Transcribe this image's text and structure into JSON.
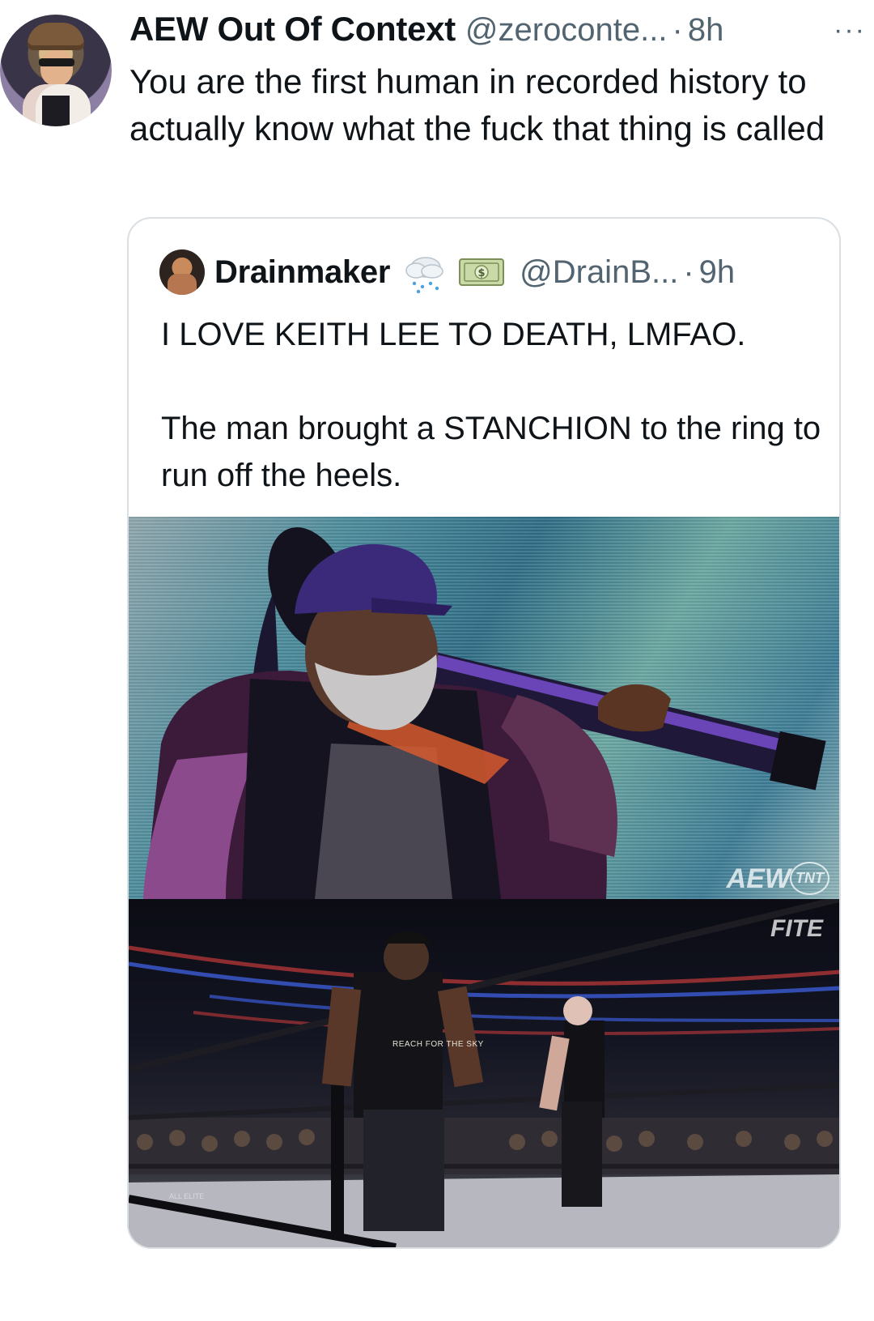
{
  "tweet": {
    "author_name": "AEW Out Of Context",
    "handle": "@zeroconte...",
    "separator": "·",
    "time": "8h",
    "more": "···",
    "text": "You are the first human in recorded history to actually know what the fuck that thing is called"
  },
  "quoted": {
    "author_name": "Drainmaker",
    "handle": "@DrainB...",
    "separator": "·",
    "time": "9h",
    "text": "I LOVE KEITH LEE TO DEATH, LMFAO.\n\nThe man brought a STANCHION to the ring to run off the heels.",
    "emoji_icons": [
      "cloud-with-rain-icon",
      "dollar-banknote-icon"
    ],
    "media": {
      "watermark_top": "AEW",
      "watermark_network": "TNT",
      "watermark_bottom": "FITE",
      "shirt_caption": "REACH FOR THE SKY",
      "banner_text": "ALL ELITE"
    }
  }
}
